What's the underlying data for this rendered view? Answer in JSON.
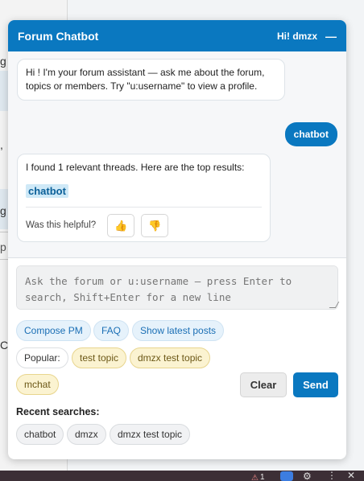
{
  "background": {
    "fragments": [
      "g",
      ",",
      "g",
      "p",
      "C+"
    ]
  },
  "taskbar": {
    "warning_count": "1"
  },
  "chat": {
    "title": "Forum Chatbot",
    "greeting": "Hi! dmzx",
    "minimize_symbol": "—",
    "messages": [
      {
        "from": "bot",
        "text": "Hi ! I'm your forum assistant — ask me about the forum, topics or members. Try \"u:username\" to view a profile."
      },
      {
        "from": "user",
        "text": "chatbot"
      },
      {
        "from": "bot",
        "text": "I found 1 relevant threads. Here are the top results:",
        "result": "chatbot",
        "feedback_label": "Was this helpful?"
      }
    ],
    "input": {
      "placeholder": "Ask the forum or u:username — press Enter to search, Shift+Enter for a new line",
      "value": ""
    },
    "quick_actions": [
      "Compose PM",
      "FAQ",
      "Show latest posts"
    ],
    "popular_label": "Popular:",
    "popular_topics": [
      "test topic",
      "dmzx test topic",
      "mchat"
    ],
    "clear_label": "Clear",
    "send_label": "Send",
    "recent_title": "Recent searches:",
    "recent_searches": [
      "chatbot",
      "dmzx",
      "dmzx test topic"
    ]
  },
  "colors": {
    "accent": "#0a78c0",
    "popular_bg": "#fbf3d1",
    "action_bg": "#e6f2fb"
  },
  "icons": {
    "thumbs_up": "thumbs-up-icon",
    "thumbs_down": "thumbs-down-icon",
    "warning": "warning-icon",
    "settings": "gear-icon"
  }
}
